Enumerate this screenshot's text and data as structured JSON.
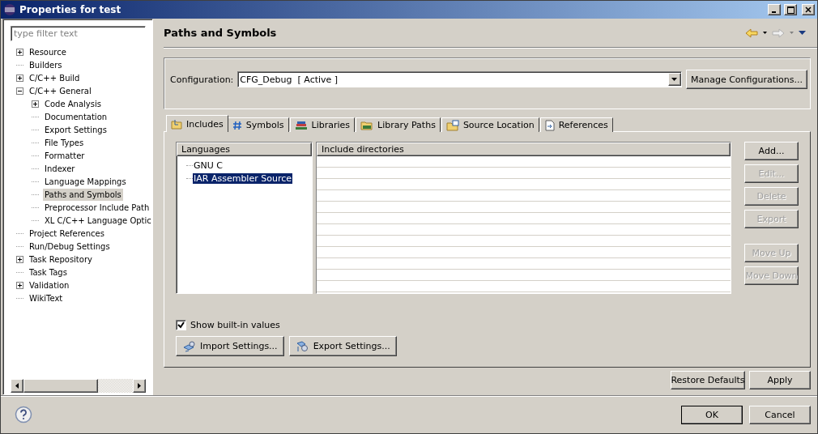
{
  "window": {
    "title": "Properties for test"
  },
  "filter": {
    "placeholder": "type filter text"
  },
  "tree": [
    {
      "label": "Resource",
      "expanded": false,
      "selected": false
    },
    {
      "label": "Builders",
      "selected": false
    },
    {
      "label": "C/C++ Build",
      "expanded": false,
      "selected": false
    },
    {
      "label": "C/C++ General",
      "expanded": true,
      "selected": false,
      "children": [
        {
          "label": "Code Analysis",
          "expanded": false,
          "selected": false
        },
        {
          "label": "Documentation",
          "selected": false
        },
        {
          "label": "Export Settings",
          "selected": false
        },
        {
          "label": "File Types",
          "selected": false
        },
        {
          "label": "Formatter",
          "selected": false
        },
        {
          "label": "Indexer",
          "selected": false
        },
        {
          "label": "Language Mappings",
          "selected": false
        },
        {
          "label": "Paths and Symbols",
          "selected": true
        },
        {
          "label": "Preprocessor Include Path",
          "selected": false
        },
        {
          "label": "XL C/C++ Language Optic",
          "selected": false
        }
      ]
    },
    {
      "label": "Project References",
      "selected": false
    },
    {
      "label": "Run/Debug Settings",
      "selected": false
    },
    {
      "label": "Task Repository",
      "expanded": false,
      "selected": false
    },
    {
      "label": "Task Tags",
      "selected": false
    },
    {
      "label": "Validation",
      "expanded": false,
      "selected": false
    },
    {
      "label": "WikiText",
      "selected": false
    }
  ],
  "page": {
    "title": "Paths and Symbols",
    "back_disabled": false,
    "forward_disabled": true
  },
  "configuration": {
    "label": "Configuration:",
    "value": "CFG_Debug  [ Active ]",
    "manage_button": "Manage Configurations..."
  },
  "tabs": [
    {
      "label": "Includes",
      "kind": "includes",
      "selected": true
    },
    {
      "label": "Symbols",
      "kind": "symbols",
      "selected": false
    },
    {
      "label": "Libraries",
      "kind": "libraries",
      "selected": false
    },
    {
      "label": "Library Paths",
      "kind": "folder",
      "selected": false
    },
    {
      "label": "Source Location",
      "kind": "source",
      "selected": false
    },
    {
      "label": "References",
      "kind": "references",
      "selected": false
    }
  ],
  "languages": {
    "header": "Languages",
    "items": [
      {
        "label": "GNU C",
        "selected": false
      },
      {
        "label": "IAR Assembler Source",
        "selected": true
      }
    ]
  },
  "include_table": {
    "header": "Include directories"
  },
  "side_buttons": [
    {
      "label": "Add...",
      "disabled": false
    },
    {
      "label": "Edit...",
      "disabled": true
    },
    {
      "label": "Delete",
      "disabled": true
    },
    {
      "label": "Export",
      "disabled": true
    },
    {
      "label": "Move Up",
      "disabled": true,
      "gap": true
    },
    {
      "label": "Move Down",
      "disabled": true
    }
  ],
  "show_builtin": {
    "label": "Show built-in values",
    "checked": true
  },
  "settings_buttons": [
    {
      "label": "Import Settings...",
      "kind": "import"
    },
    {
      "label": "Export Settings...",
      "kind": "export"
    }
  ],
  "page_buttons": [
    "Restore Defaults",
    "Apply"
  ],
  "dialog_buttons": [
    {
      "label": "OK",
      "default": true
    },
    {
      "label": "Cancel",
      "default": false
    }
  ]
}
